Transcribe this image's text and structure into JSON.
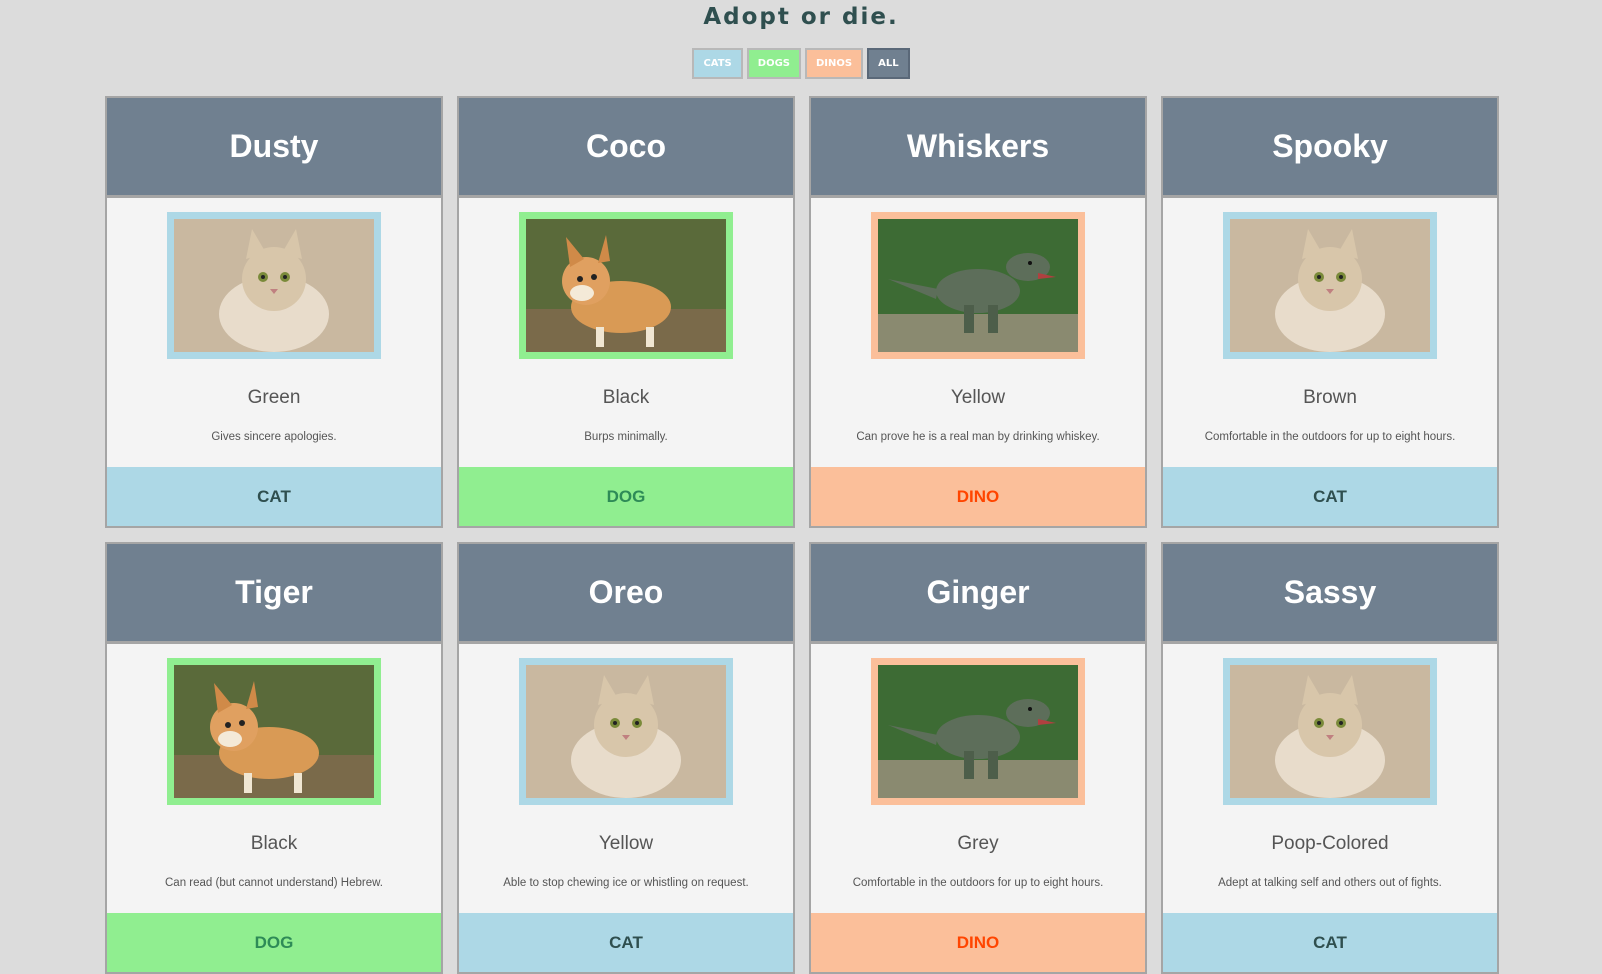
{
  "page": {
    "title": "Adopt or die."
  },
  "filters": {
    "cats": "CATS",
    "dogs": "DOGS",
    "dinos": "DINOS",
    "all": "ALL"
  },
  "pets": [
    {
      "name": "Dusty",
      "color": "Green",
      "desc": "Gives sincere apologies.",
      "type": "CAT",
      "photo": "cat-photo"
    },
    {
      "name": "Coco",
      "color": "Black",
      "desc": "Burps minimally.",
      "type": "DOG",
      "photo": "dog-photo"
    },
    {
      "name": "Whiskers",
      "color": "Yellow",
      "desc": "Can prove he is a real man by drinking whiskey.",
      "type": "DINO",
      "photo": "dino-photo"
    },
    {
      "name": "Spooky",
      "color": "Brown",
      "desc": "Comfortable in the outdoors for up to eight hours.",
      "type": "CAT",
      "photo": "cat-photo"
    },
    {
      "name": "Tiger",
      "color": "Black",
      "desc": "Can read (but cannot understand) Hebrew.",
      "type": "DOG",
      "photo": "dog-photo"
    },
    {
      "name": "Oreo",
      "color": "Yellow",
      "desc": "Able to stop chewing ice or whistling on request.",
      "type": "CAT",
      "photo": "cat-photo"
    },
    {
      "name": "Ginger",
      "color": "Grey",
      "desc": "Comfortable in the outdoors for up to eight hours.",
      "type": "DINO",
      "photo": "dino-photo"
    },
    {
      "name": "Sassy",
      "color": "Poop-Colored",
      "desc": "Adept at talking self and others out of fights.",
      "type": "CAT",
      "photo": "cat-photo"
    }
  ],
  "colors": {
    "background": "#dcdcdc",
    "header": "#708090",
    "cat": "#add8e6",
    "dog": "#90ee90",
    "dino": "#fbbf9a",
    "cat_text": "#2f4f4f",
    "dog_text": "#2e8b57",
    "dino_text": "#ff4500"
  }
}
